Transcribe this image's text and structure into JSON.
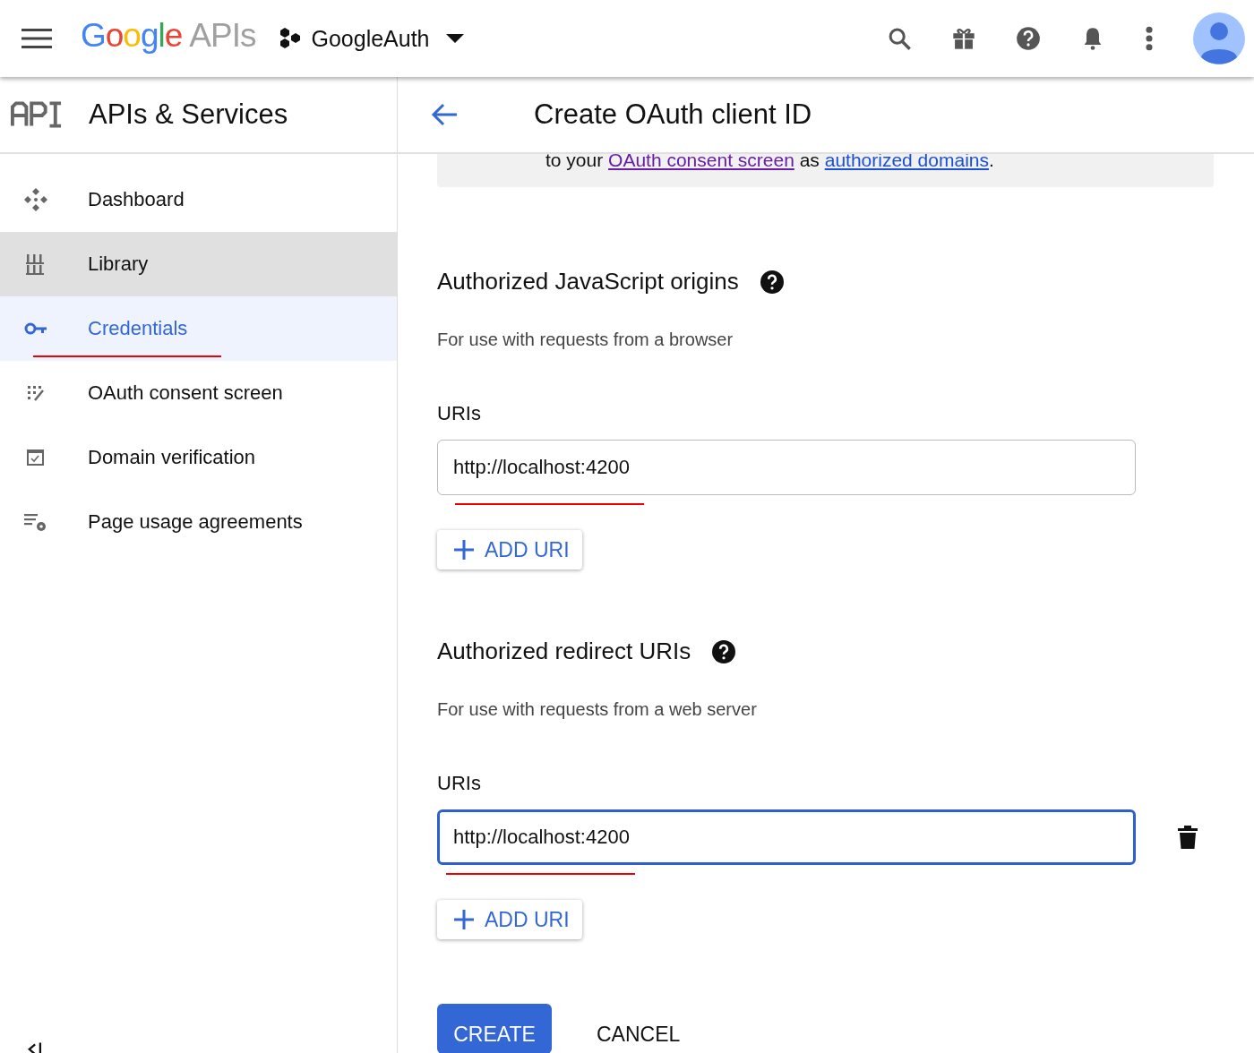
{
  "top_bar": {
    "logo": {
      "google": "Google",
      "suffix": "APIs"
    },
    "project": "GoogleAuth"
  },
  "sidebar": {
    "title": "APIs & Services",
    "items": [
      {
        "label": "Dashboard",
        "kind": "dashboard",
        "selected": false,
        "hovered": false
      },
      {
        "label": "Library",
        "kind": "library",
        "selected": false,
        "hovered": true
      },
      {
        "label": "Credentials",
        "kind": "key",
        "selected": true,
        "hovered": false
      },
      {
        "label": "OAuth consent screen",
        "kind": "consent",
        "selected": false,
        "hovered": false
      },
      {
        "label": "Domain verification",
        "kind": "domain",
        "selected": false,
        "hovered": false
      },
      {
        "label": "Page usage agreements",
        "kind": "usage",
        "selected": false,
        "hovered": false
      }
    ]
  },
  "page": {
    "title": "Create OAuth client ID",
    "notice": {
      "before": "to your ",
      "link1": "OAuth consent screen",
      "middle": " as ",
      "link2": "authorized domains",
      "after": "."
    },
    "sections": [
      {
        "heading": "Authorized JavaScript origins",
        "description": "For use with requests from a browser",
        "field_label": "URIs",
        "uri": "http://localhost:4200",
        "focused": false,
        "removable": false,
        "add_button": "ADD URI"
      },
      {
        "heading": "Authorized redirect URIs",
        "description": "For use with requests from a web server",
        "field_label": "URIs",
        "uri": "http://localhost:4200",
        "focused": true,
        "removable": true,
        "add_button": "ADD URI"
      }
    ],
    "create_button": "CREATE",
    "cancel_button": "CANCEL"
  }
}
